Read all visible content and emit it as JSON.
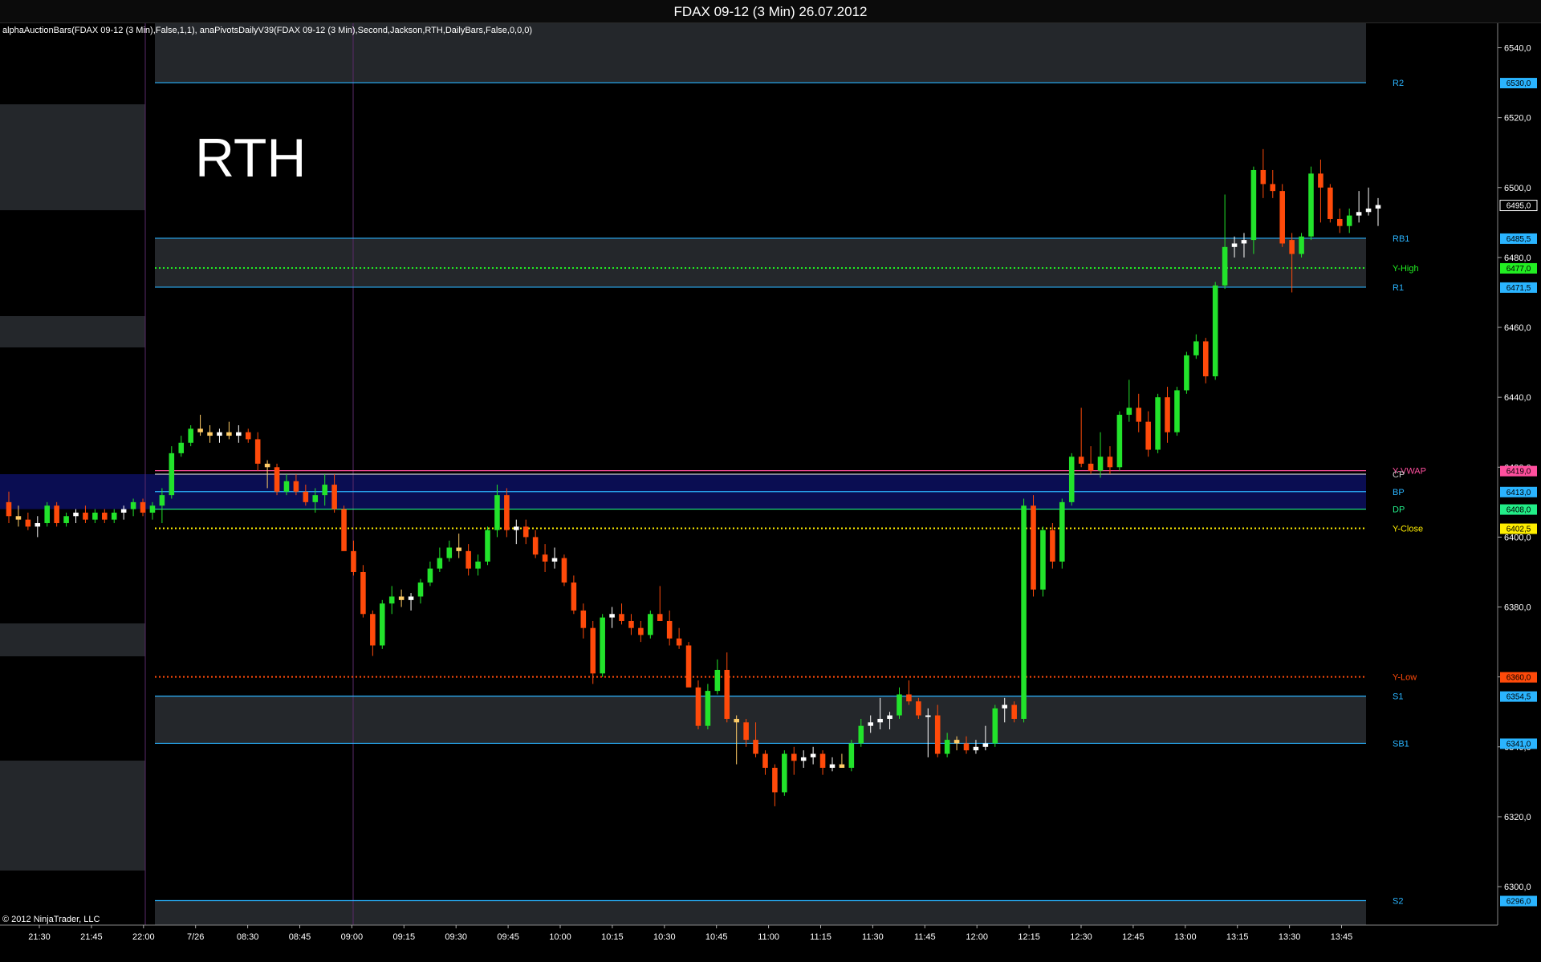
{
  "window": {
    "title": "FDAX 09-12 (3 Min)  26.07.2012"
  },
  "indicator_label": "alphaAuctionBars(FDAX 09-12 (3 Min),False,1,1), anaPivotsDailyV39(FDAX 09-12 (3 Min),Second,Jackson,RTH,DailyBars,False,0,0,0)",
  "session_label": "RTH",
  "copyright": "© 2012 NinjaTrader, LLC",
  "colors": {
    "up": "#22e32b",
    "down": "#ff4a0a",
    "doji_up": "#ffffff",
    "doji_down": "#ffcc66",
    "pivot_line": "#2ab4ff",
    "band": "#24272b",
    "blue_band": "#0c0f60",
    "vwap": "#ff4f9e",
    "y_high": "#22ee22",
    "y_low": "#ff4a0a",
    "y_close": "#ffee00"
  },
  "chart_data": {
    "type": "candlestick",
    "title": "FDAX 09-12 (3 Min)  26.07.2012",
    "ylim": [
      6289,
      6547
    ],
    "y_ticks": [
      "6540,0",
      "6520,0",
      "6500,0",
      "6480,0",
      "6460,0",
      "6440,0",
      "6420,0",
      "6400,0",
      "6380,0",
      "6360,0",
      "6340,0",
      "6320,0",
      "6300,0"
    ],
    "x_ticks": [
      "21:30",
      "21:45",
      "22:00",
      "7/26",
      "08:30",
      "08:45",
      "09:00",
      "09:15",
      "09:30",
      "09:45",
      "10:00",
      "10:15",
      "10:30",
      "10:45",
      "11:00",
      "11:15",
      "11:30",
      "11:45",
      "12:00",
      "12:15",
      "12:30",
      "12:45",
      "13:00",
      "13:15",
      "13:30",
      "13:45"
    ],
    "levels": [
      {
        "name": "R2",
        "value": 6530.0,
        "price": "6530,0",
        "color": "#2ab4ff",
        "style": "solid"
      },
      {
        "name": "RB1",
        "value": 6485.5,
        "price": "6485,5",
        "color": "#2ab4ff",
        "style": "solid"
      },
      {
        "name": "Y-High",
        "value": 6477.0,
        "price": "6477,0",
        "color": "#22ee22",
        "style": "dotted"
      },
      {
        "name": "R1",
        "value": 6471.5,
        "price": "6471,5",
        "color": "#2ab4ff",
        "style": "solid"
      },
      {
        "name": "Y-VWAP",
        "value": 6419.0,
        "price": "6419,0",
        "color": "#ff4f9e",
        "style": "solid"
      },
      {
        "name": "CP",
        "value": 6418.0,
        "price": "",
        "color": "#cccccc",
        "style": "solid"
      },
      {
        "name": "BP",
        "value": 6413.0,
        "price": "6413,0",
        "color": "#2ab4ff",
        "style": "solid"
      },
      {
        "name": "DP",
        "value": 6408.0,
        "price": "6408,0",
        "color": "#22ee88",
        "style": "solid"
      },
      {
        "name": "Y-Close",
        "value": 6402.5,
        "price": "6402,5",
        "color": "#ffee00",
        "style": "dotted"
      },
      {
        "name": "Y-Low",
        "value": 6360.0,
        "price": "6360,0",
        "color": "#ff4a0a",
        "style": "dotted"
      },
      {
        "name": "S1",
        "value": 6354.5,
        "price": "6354,5",
        "color": "#2ab4ff",
        "style": "solid"
      },
      {
        "name": "SB1",
        "value": 6341.0,
        "price": "6341,0",
        "color": "#2ab4ff",
        "style": "solid"
      },
      {
        "name": "S2",
        "value": 6296.0,
        "price": "6296,0",
        "color": "#2ab4ff",
        "style": "solid"
      }
    ],
    "last_price": "6495,0",
    "candles": [
      {
        "o": 6410,
        "h": 6413,
        "l": 6404,
        "c": 6406
      },
      {
        "o": 6406,
        "h": 6409,
        "l": 6403,
        "c": 6405
      },
      {
        "o": 6405,
        "h": 6407,
        "l": 6402,
        "c": 6403
      },
      {
        "o": 6403,
        "h": 6406,
        "l": 6400,
        "c": 6404
      },
      {
        "o": 6404,
        "h": 6410,
        "l": 6403,
        "c": 6409
      },
      {
        "o": 6409,
        "h": 6410,
        "l": 6403,
        "c": 6404
      },
      {
        "o": 6404,
        "h": 6407,
        "l": 6403,
        "c": 6406
      },
      {
        "o": 6406,
        "h": 6408,
        "l": 6404,
        "c": 6407
      },
      {
        "o": 6407,
        "h": 6409,
        "l": 6404,
        "c": 6405
      },
      {
        "o": 6405,
        "h": 6408,
        "l": 6404,
        "c": 6407
      },
      {
        "o": 6407,
        "h": 6408,
        "l": 6404,
        "c": 6405
      },
      {
        "o": 6405,
        "h": 6408,
        "l": 6404,
        "c": 6407
      },
      {
        "o": 6407,
        "h": 6409,
        "l": 6405,
        "c": 6408
      },
      {
        "o": 6408,
        "h": 6411,
        "l": 6406,
        "c": 6410
      },
      {
        "o": 6410,
        "h": 6411,
        "l": 6406,
        "c": 6407
      },
      {
        "o": 6407,
        "h": 6410,
        "l": 6405,
        "c": 6409
      },
      {
        "o": 6409,
        "h": 6414,
        "l": 6404,
        "c": 6412
      },
      {
        "o": 6412,
        "h": 6426,
        "l": 6411,
        "c": 6424
      },
      {
        "o": 6424,
        "h": 6429,
        "l": 6423,
        "c": 6427
      },
      {
        "o": 6427,
        "h": 6432,
        "l": 6426,
        "c": 6431
      },
      {
        "o": 6431,
        "h": 6435,
        "l": 6429,
        "c": 6430
      },
      {
        "o": 6430,
        "h": 6432,
        "l": 6427,
        "c": 6429
      },
      {
        "o": 6429,
        "h": 6431,
        "l": 6427,
        "c": 6430
      },
      {
        "o": 6430,
        "h": 6433,
        "l": 6428,
        "c": 6429
      },
      {
        "o": 6429,
        "h": 6432,
        "l": 6427,
        "c": 6430
      },
      {
        "o": 6430,
        "h": 6431,
        "l": 6427,
        "c": 6428
      },
      {
        "o": 6428,
        "h": 6430,
        "l": 6419,
        "c": 6421
      },
      {
        "o": 6421,
        "h": 6422,
        "l": 6414,
        "c": 6420
      },
      {
        "o": 6420,
        "h": 6421,
        "l": 6412,
        "c": 6413
      },
      {
        "o": 6413,
        "h": 6418,
        "l": 6412,
        "c": 6416
      },
      {
        "o": 6416,
        "h": 6418,
        "l": 6412,
        "c": 6413
      },
      {
        "o": 6413,
        "h": 6415,
        "l": 6409,
        "c": 6410
      },
      {
        "o": 6410,
        "h": 6414,
        "l": 6407,
        "c": 6412
      },
      {
        "o": 6412,
        "h": 6418,
        "l": 6409,
        "c": 6415
      },
      {
        "o": 6415,
        "h": 6418,
        "l": 6407,
        "c": 6408
      },
      {
        "o": 6408,
        "h": 6409,
        "l": 6397,
        "c": 6396
      },
      {
        "o": 6396,
        "h": 6399,
        "l": 6389,
        "c": 6390
      },
      {
        "o": 6390,
        "h": 6392,
        "l": 6377,
        "c": 6378
      },
      {
        "o": 6378,
        "h": 6379,
        "l": 6366,
        "c": 6369
      },
      {
        "o": 6369,
        "h": 6382,
        "l": 6368,
        "c": 6381
      },
      {
        "o": 6381,
        "h": 6386,
        "l": 6378,
        "c": 6383
      },
      {
        "o": 6383,
        "h": 6385,
        "l": 6380,
        "c": 6382
      },
      {
        "o": 6382,
        "h": 6384,
        "l": 6379,
        "c": 6383
      },
      {
        "o": 6383,
        "h": 6388,
        "l": 6381,
        "c": 6387
      },
      {
        "o": 6387,
        "h": 6393,
        "l": 6386,
        "c": 6391
      },
      {
        "o": 6391,
        "h": 6397,
        "l": 6390,
        "c": 6394
      },
      {
        "o": 6394,
        "h": 6399,
        "l": 6393,
        "c": 6397
      },
      {
        "o": 6397,
        "h": 6401,
        "l": 6394,
        "c": 6396
      },
      {
        "o": 6396,
        "h": 6398,
        "l": 6389,
        "c": 6391
      },
      {
        "o": 6391,
        "h": 6395,
        "l": 6389,
        "c": 6393
      },
      {
        "o": 6393,
        "h": 6403,
        "l": 6392,
        "c": 6402
      },
      {
        "o": 6402,
        "h": 6415,
        "l": 6400,
        "c": 6412
      },
      {
        "o": 6412,
        "h": 6414,
        "l": 6400,
        "c": 6402
      },
      {
        "o": 6402,
        "h": 6405,
        "l": 6398,
        "c": 6403
      },
      {
        "o": 6403,
        "h": 6405,
        "l": 6398,
        "c": 6400
      },
      {
        "o": 6400,
        "h": 6402,
        "l": 6394,
        "c": 6395
      },
      {
        "o": 6395,
        "h": 6398,
        "l": 6390,
        "c": 6393
      },
      {
        "o": 6393,
        "h": 6397,
        "l": 6391,
        "c": 6394
      },
      {
        "o": 6394,
        "h": 6395,
        "l": 6386,
        "c": 6387
      },
      {
        "o": 6387,
        "h": 6389,
        "l": 6378,
        "c": 6379
      },
      {
        "o": 6379,
        "h": 6381,
        "l": 6371,
        "c": 6374
      },
      {
        "o": 6374,
        "h": 6376,
        "l": 6358,
        "c": 6361
      },
      {
        "o": 6361,
        "h": 6378,
        "l": 6360,
        "c": 6377
      },
      {
        "o": 6377,
        "h": 6380,
        "l": 6374,
        "c": 6378
      },
      {
        "o": 6378,
        "h": 6381,
        "l": 6375,
        "c": 6376
      },
      {
        "o": 6376,
        "h": 6378,
        "l": 6372,
        "c": 6374
      },
      {
        "o": 6374,
        "h": 6376,
        "l": 6370,
        "c": 6372
      },
      {
        "o": 6372,
        "h": 6379,
        "l": 6371,
        "c": 6378
      },
      {
        "o": 6378,
        "h": 6386,
        "l": 6376,
        "c": 6376
      },
      {
        "o": 6376,
        "h": 6379,
        "l": 6369,
        "c": 6371
      },
      {
        "o": 6371,
        "h": 6374,
        "l": 6368,
        "c": 6369
      },
      {
        "o": 6369,
        "h": 6370,
        "l": 6360,
        "c": 6357
      },
      {
        "o": 6357,
        "h": 6359,
        "l": 6345,
        "c": 6346
      },
      {
        "o": 6346,
        "h": 6358,
        "l": 6345,
        "c": 6356
      },
      {
        "o": 6356,
        "h": 6365,
        "l": 6355,
        "c": 6362
      },
      {
        "o": 6362,
        "h": 6367,
        "l": 6347,
        "c": 6348
      },
      {
        "o": 6348,
        "h": 6349,
        "l": 6335,
        "c": 6347
      },
      {
        "o": 6347,
        "h": 6348,
        "l": 6340,
        "c": 6342
      },
      {
        "o": 6342,
        "h": 6347,
        "l": 6337,
        "c": 6338
      },
      {
        "o": 6338,
        "h": 6339,
        "l": 6332,
        "c": 6334
      },
      {
        "o": 6334,
        "h": 6335,
        "l": 6323,
        "c": 6327
      },
      {
        "o": 6327,
        "h": 6339,
        "l": 6326,
        "c": 6338
      },
      {
        "o": 6338,
        "h": 6340,
        "l": 6332,
        "c": 6336
      },
      {
        "o": 6336,
        "h": 6339,
        "l": 6334,
        "c": 6337
      },
      {
        "o": 6337,
        "h": 6340,
        "l": 6335,
        "c": 6338
      },
      {
        "o": 6338,
        "h": 6339,
        "l": 6332,
        "c": 6334
      },
      {
        "o": 6334,
        "h": 6337,
        "l": 6333,
        "c": 6335
      },
      {
        "o": 6335,
        "h": 6338,
        "l": 6334,
        "c": 6334
      },
      {
        "o": 6334,
        "h": 6342,
        "l": 6333,
        "c": 6341
      },
      {
        "o": 6341,
        "h": 6348,
        "l": 6340,
        "c": 6346
      },
      {
        "o": 6346,
        "h": 6349,
        "l": 6344,
        "c": 6347
      },
      {
        "o": 6347,
        "h": 6354,
        "l": 6345,
        "c": 6348
      },
      {
        "o": 6348,
        "h": 6350,
        "l": 6345,
        "c": 6349
      },
      {
        "o": 6349,
        "h": 6357,
        "l": 6348,
        "c": 6355
      },
      {
        "o": 6355,
        "h": 6359,
        "l": 6352,
        "c": 6353
      },
      {
        "o": 6353,
        "h": 6354,
        "l": 6348,
        "c": 6349
      },
      {
        "o": 6349,
        "h": 6351,
        "l": 6337,
        "c": 6349
      },
      {
        "o": 6349,
        "h": 6352,
        "l": 6337,
        "c": 6338
      },
      {
        "o": 6338,
        "h": 6344,
        "l": 6337,
        "c": 6342
      },
      {
        "o": 6342,
        "h": 6343,
        "l": 6339,
        "c": 6341
      },
      {
        "o": 6341,
        "h": 6343,
        "l": 6338,
        "c": 6339
      },
      {
        "o": 6339,
        "h": 6342,
        "l": 6338,
        "c": 6340
      },
      {
        "o": 6340,
        "h": 6346,
        "l": 6339,
        "c": 6341
      },
      {
        "o": 6341,
        "h": 6352,
        "l": 6340,
        "c": 6351
      },
      {
        "o": 6351,
        "h": 6354,
        "l": 6347,
        "c": 6352
      },
      {
        "o": 6352,
        "h": 6353,
        "l": 6347,
        "c": 6348
      },
      {
        "o": 6348,
        "h": 6411,
        "l": 6347,
        "c": 6409
      },
      {
        "o": 6409,
        "h": 6412,
        "l": 6383,
        "c": 6385
      },
      {
        "o": 6385,
        "h": 6403,
        "l": 6383,
        "c": 6402
      },
      {
        "o": 6402,
        "h": 6404,
        "l": 6391,
        "c": 6393
      },
      {
        "o": 6393,
        "h": 6411,
        "l": 6391,
        "c": 6410
      },
      {
        "o": 6410,
        "h": 6424,
        "l": 6409,
        "c": 6423
      },
      {
        "o": 6423,
        "h": 6437,
        "l": 6420,
        "c": 6421
      },
      {
        "o": 6421,
        "h": 6426,
        "l": 6418,
        "c": 6419
      },
      {
        "o": 6419,
        "h": 6430,
        "l": 6417,
        "c": 6423
      },
      {
        "o": 6423,
        "h": 6426,
        "l": 6418,
        "c": 6420
      },
      {
        "o": 6420,
        "h": 6436,
        "l": 6419,
        "c": 6435
      },
      {
        "o": 6435,
        "h": 6445,
        "l": 6433,
        "c": 6437
      },
      {
        "o": 6437,
        "h": 6441,
        "l": 6430,
        "c": 6433
      },
      {
        "o": 6433,
        "h": 6436,
        "l": 6423,
        "c": 6425
      },
      {
        "o": 6425,
        "h": 6441,
        "l": 6424,
        "c": 6440
      },
      {
        "o": 6440,
        "h": 6443,
        "l": 6427,
        "c": 6430
      },
      {
        "o": 6430,
        "h": 6443,
        "l": 6429,
        "c": 6442
      },
      {
        "o": 6442,
        "h": 6453,
        "l": 6441,
        "c": 6452
      },
      {
        "o": 6452,
        "h": 6458,
        "l": 6451,
        "c": 6456
      },
      {
        "o": 6456,
        "h": 6457,
        "l": 6444,
        "c": 6446
      },
      {
        "o": 6446,
        "h": 6473,
        "l": 6445,
        "c": 6472
      },
      {
        "o": 6472,
        "h": 6498,
        "l": 6471,
        "c": 6483
      },
      {
        "o": 6483,
        "h": 6486,
        "l": 6480,
        "c": 6484
      },
      {
        "o": 6484,
        "h": 6487,
        "l": 6480,
        "c": 6485
      },
      {
        "o": 6485,
        "h": 6506,
        "l": 6481,
        "c": 6505
      },
      {
        "o": 6505,
        "h": 6511,
        "l": 6497,
        "c": 6501
      },
      {
        "o": 6501,
        "h": 6505,
        "l": 6497,
        "c": 6499
      },
      {
        "o": 6499,
        "h": 6501,
        "l": 6483,
        "c": 6484
      },
      {
        "o": 6485,
        "h": 6487,
        "l": 6470,
        "c": 6481
      },
      {
        "o": 6481,
        "h": 6487,
        "l": 6480,
        "c": 6486
      },
      {
        "o": 6486,
        "h": 6506,
        "l": 6485,
        "c": 6504
      },
      {
        "o": 6504,
        "h": 6508,
        "l": 6490,
        "c": 6500
      },
      {
        "o": 6500,
        "h": 6501,
        "l": 6490,
        "c": 6491
      },
      {
        "o": 6491,
        "h": 6494,
        "l": 6487,
        "c": 6489
      },
      {
        "o": 6489,
        "h": 6494,
        "l": 6487,
        "c": 6492
      },
      {
        "o": 6492,
        "h": 6499,
        "l": 6490,
        "c": 6493
      },
      {
        "o": 6493,
        "h": 6500,
        "l": 6492,
        "c": 6494
      },
      {
        "o": 6494,
        "h": 6497,
        "l": 6489,
        "c": 6495
      }
    ]
  }
}
